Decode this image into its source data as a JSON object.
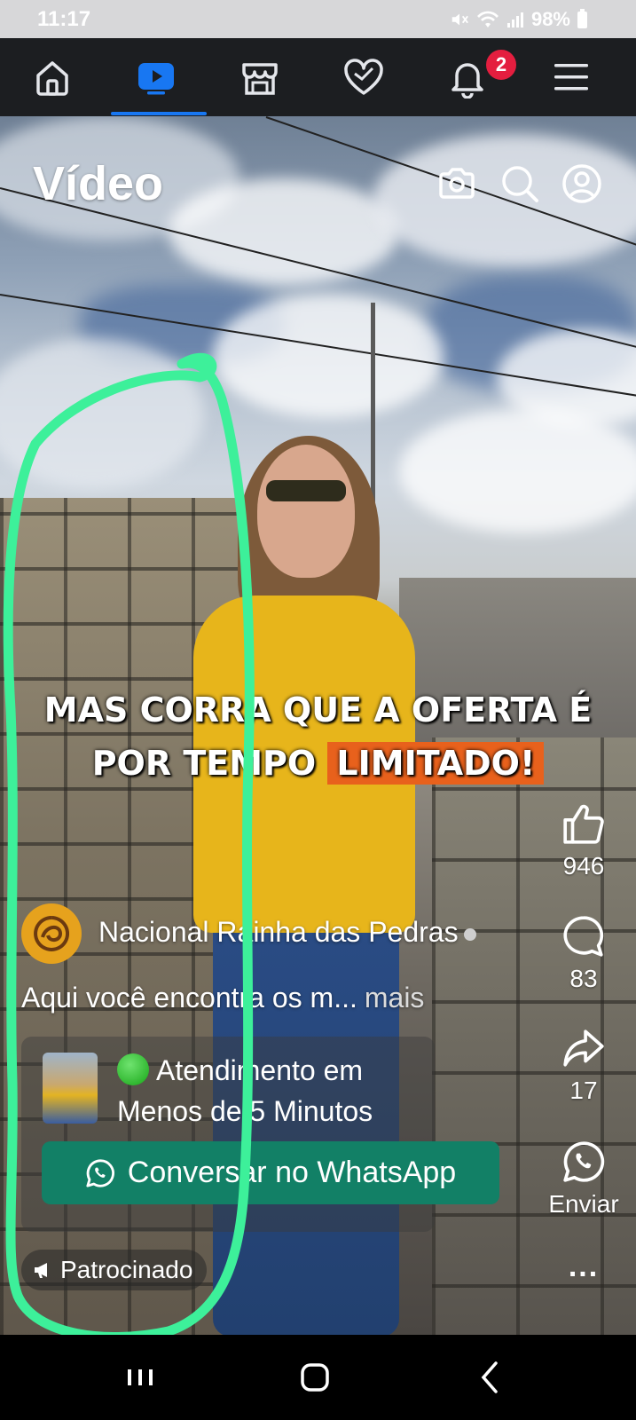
{
  "status_bar": {
    "time": "11:17",
    "battery": "98%"
  },
  "top_nav": {
    "items": [
      "home-icon",
      "video-icon",
      "marketplace-icon",
      "dating-icon",
      "notifications-icon",
      "menu-icon"
    ],
    "active": "video-icon",
    "notification_count": "2",
    "accent_color": "#1877f2"
  },
  "header": {
    "title": "Vídeo"
  },
  "video": {
    "caption_line1": "MAS CORRA QUE A OFERTA É",
    "caption_line2_prefix": "POR TEMPO",
    "caption_line2_highlight": "LIMITADO!"
  },
  "actions": {
    "likes": "946",
    "comments": "83",
    "shares": "17",
    "send_label": "Enviar",
    "more": "..."
  },
  "post": {
    "author": "Nacional Rainha das Pedras",
    "description": "Aqui você encontra os m...",
    "more_label": "mais",
    "promo_line1": "Atendimento em",
    "promo_line2": "Menos de 5 Minutos",
    "cta_label": "Conversar no WhatsApp",
    "cta_color": "#128066",
    "sponsored_label": "Patrocinado"
  }
}
